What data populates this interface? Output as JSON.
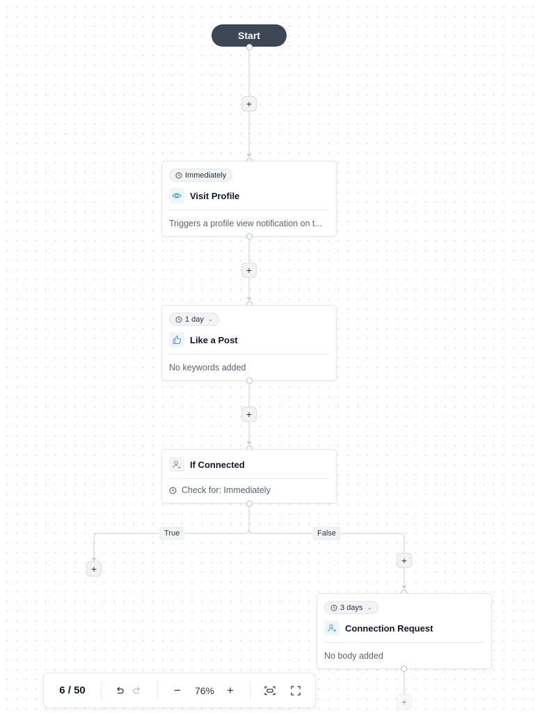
{
  "canvas": {
    "start_label": "Start",
    "add_symbol": "+"
  },
  "nodes": {
    "visit_profile": {
      "delay": "Immediately",
      "title": "Visit Profile",
      "description": "Triggers a profile view notification on t..."
    },
    "like_post": {
      "delay": "1 day",
      "title": "Like a Post",
      "description": "No keywords added"
    },
    "if_connected": {
      "title": "If Connected",
      "check": "Check for: Immediately"
    },
    "connection_request": {
      "delay": "3 days",
      "title": "Connection Request",
      "description": "No body added"
    }
  },
  "branches": {
    "true_label": "True",
    "false_label": "False"
  },
  "toolbar": {
    "page_count": "6 / 50",
    "zoom": "76%",
    "zoom_out": "−",
    "zoom_in": "+"
  },
  "colors": {
    "start_node": "#3d4654",
    "accent_icon": "#4aa3d8"
  }
}
